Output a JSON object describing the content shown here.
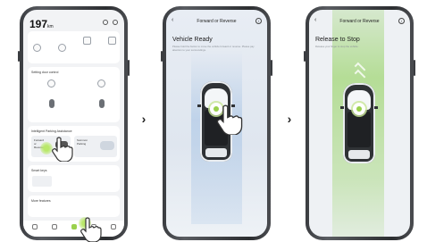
{
  "screen1": {
    "header_value": "197",
    "header_unit": "km",
    "section_remote": "Setting door control",
    "section_parking": "Intelligent Parking Assistance",
    "parking_option1": "Forward or Reverse",
    "parking_option2": "Summon Parking",
    "section_smart": "Smart keys",
    "section_more": "More features"
  },
  "screen2": {
    "nav_title": "Forward or Reverse",
    "headline": "Vehicle Ready",
    "subtext": "Please hold the button to move the vehicle forward or reverse. Please pay attention to your surroundings."
  },
  "screen3": {
    "nav_title": "Forward or Reverse",
    "headline": "Release to Stop",
    "subtext": "Release your finger to stop the vehicle."
  },
  "colors": {
    "accent_green": "#9ad14d",
    "frame": "#3a3c40"
  },
  "icons": {
    "back": "chevron-left-icon",
    "info": "info-icon",
    "next": "chevron-right-icon",
    "hand": "hand-pointer-icon"
  }
}
